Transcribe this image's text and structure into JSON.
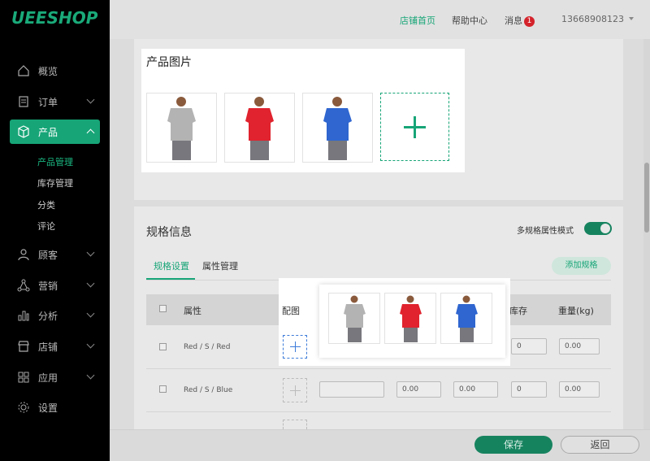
{
  "app": {
    "logo": "UEESHOP"
  },
  "header": {
    "store_home": "店铺首页",
    "help_center": "帮助中心",
    "messages": "消息",
    "message_count": "1",
    "account": "13668908123"
  },
  "sidebar": {
    "items": [
      {
        "label": "概览",
        "icon": "home-icon"
      },
      {
        "label": "订单",
        "icon": "order-icon"
      },
      {
        "label": "产品",
        "icon": "box-icon",
        "active": true
      },
      {
        "label": "顾客",
        "icon": "user-icon"
      },
      {
        "label": "营销",
        "icon": "network-icon"
      },
      {
        "label": "分析",
        "icon": "bar-chart-icon"
      },
      {
        "label": "店铺",
        "icon": "store-icon"
      },
      {
        "label": "应用",
        "icon": "apps-icon"
      },
      {
        "label": "设置",
        "icon": "gear-icon"
      }
    ],
    "product_sub": [
      "产品管理",
      "库存管理",
      "分类",
      "评论"
    ]
  },
  "product_images": {
    "title": "产品图片",
    "shirts": [
      "gray",
      "red",
      "blue"
    ],
    "colors": {
      "gray": "#b3b3b3",
      "red": "#e0232e",
      "blue": "#2f66d0",
      "pants": "#77777d",
      "skin": "#8a5a3c"
    }
  },
  "specs": {
    "title": "规格信息",
    "multi_mode_label": "多规格属性模式",
    "tabs": [
      "规格设置",
      "属性管理"
    ],
    "add_spec": "添加规格",
    "columns": {
      "attribute": "属性",
      "image": "配图",
      "stock": "库存",
      "weight": "重量(kg)"
    },
    "rows": [
      {
        "attribute": "Red / S / Red",
        "stock": "0",
        "weight": "0.00"
      },
      {
        "attribute": "Red / S / Blue",
        "price1": "0.00",
        "price2": "0.00",
        "stock": "0",
        "weight": "0.00"
      }
    ]
  },
  "footer": {
    "save": "保存",
    "back": "返回"
  },
  "accent": "#17a577"
}
